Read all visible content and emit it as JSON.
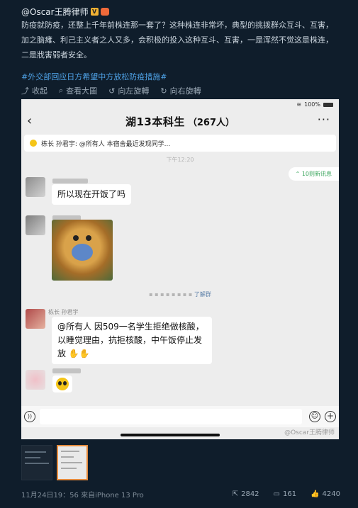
{
  "post": {
    "author": "@Oscar王腾律师",
    "body": "防疫就防疫，还整上千年前株连那一套了？这种株连非常坏，典型的挑拨群众互斗、互害，加之脑瘫、利己主义者之人又多，会积极的投入这种互斗、互害，一是浑然不觉这是株连，二是戕害弱者安全。",
    "hashtag": "#外交部回应日方希望中方放松防疫措施#",
    "actions": {
      "collapse": "收起",
      "view_large": "查看大圖",
      "rotate_left": "向左旋轉",
      "rotate_right": "向右旋轉"
    }
  },
  "screenshot": {
    "status_time": "",
    "battery": "100%",
    "chat_title": "湖13本科生",
    "member_count": "（267人）",
    "pinned": "栋长 孙君宇: @所有人 本宿舍最近发现同学...",
    "timestamp": "下午12:20",
    "new_messages": "10则新讯息",
    "msg1": "所以现在开饭了吗",
    "sysline_suffix": "了解群",
    "speaker": "栋长 孙君宇",
    "msg_announce": "@所有人 因509一名学生拒绝做核酸，以睡觉理由，抗拒核酸，中午饭停止发放",
    "watermark": "@Oscar王腾律师"
  },
  "footer": {
    "time": "11月24日19：56 來自iPhone 13 Pro",
    "reposts": "2842",
    "comments": "161",
    "likes": "4240"
  },
  "colors": {
    "background": "#0f1d2b",
    "hashtag": "#4fa3e8",
    "chat_bg": "#ededed",
    "selected_thumb_border": "#e58b3d"
  }
}
